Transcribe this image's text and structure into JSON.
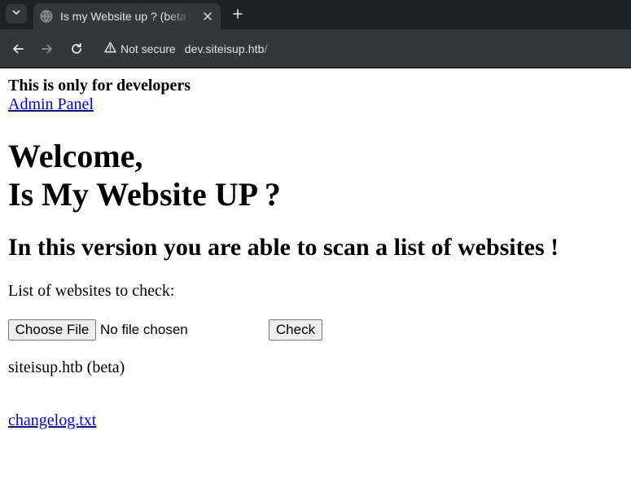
{
  "browser": {
    "tab": {
      "title": "Is my Website up ? (beta version)"
    },
    "address_bar": {
      "security_label": "Not secure",
      "host": "dev.siteisup.htb",
      "path": "/"
    }
  },
  "page": {
    "dev_note": "This is only for developers",
    "admin_link": "Admin Panel",
    "welcome_line1": "Welcome,",
    "welcome_line2": "Is My Website UP ?",
    "subtitle": "In this version you are able to scan a list of websites !",
    "list_label": "List of websites to check:",
    "file_button": "Choose File",
    "file_status": "No file chosen",
    "check_button": "Check",
    "beta_text": "siteisup.htb (beta)",
    "changelog_link": "changelog.txt"
  },
  "colors": {
    "chrome_dark": "#1f2023",
    "chrome_toolbar": "#35363a",
    "link": "#0000ee"
  },
  "icons": [
    "chevron-down-icon",
    "globe-icon",
    "close-icon",
    "plus-icon",
    "back-arrow-icon",
    "forward-arrow-icon",
    "reload-icon",
    "warning-icon"
  ]
}
